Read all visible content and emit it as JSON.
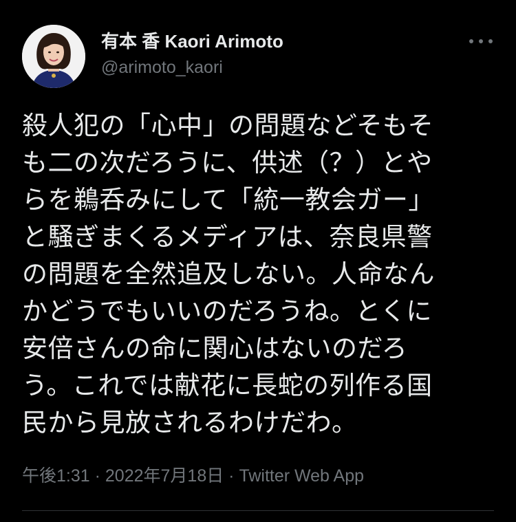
{
  "author": {
    "display_name": "有本 香 Kaori Arimoto",
    "handle": "@arimoto_kaori",
    "avatar_icon": "profile-photo"
  },
  "more_icon": "more-horizontal-icon",
  "tweet": {
    "lines": [
      "殺人犯の「心中」の問題などそもそ",
      "も二の次だろうに、供述（？）とや",
      "らを鵜呑みにして「統一教会ガー」",
      "と騒ぎまくるメディアは、奈良県警",
      "の問題を全然追及しない。人命なん",
      "かどうでもいいのだろうね。とくに",
      "安倍さんの命に関心はないのだろ",
      "う。これでは献花に長蛇の列作る国",
      "民から見放されるわけだわ。"
    ]
  },
  "meta": {
    "time": "午後1:31",
    "separator1": " · ",
    "date": "2022年7月18日",
    "separator2": " · ",
    "source": "Twitter Web App"
  },
  "colors": {
    "background": "#000000",
    "primary_text": "#e7e9ea",
    "secondary_text": "#71767b",
    "divider": "#2f3336"
  }
}
